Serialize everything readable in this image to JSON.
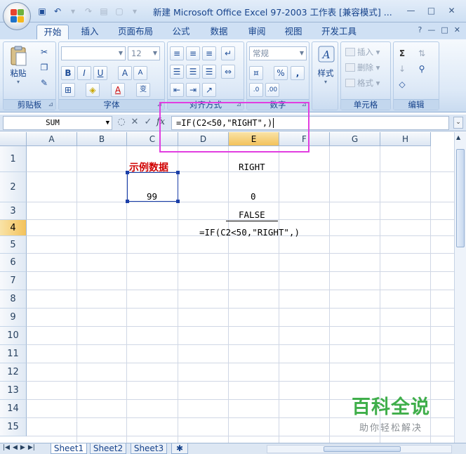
{
  "window": {
    "title": "新建 Microsoft Office Excel 97-2003 工作表 [兼容模式] ...",
    "controls": [
      "—",
      "□",
      "✕"
    ]
  },
  "quick_access": {
    "save_icon": "save-icon",
    "undo_icon": "undo-icon",
    "redo_icon": "redo-icon"
  },
  "tabs": [
    "开始",
    "插入",
    "页面布局",
    "公式",
    "数据",
    "审阅",
    "视图",
    "开发工具"
  ],
  "tab_controls": [
    "?",
    "—",
    "□",
    "✕"
  ],
  "ribbon": {
    "clipboard": {
      "label": "剪贴板",
      "paste": "粘贴"
    },
    "font": {
      "label": "字体",
      "font_name": "",
      "font_size": "12"
    },
    "alignment": {
      "label": "对齐方式"
    },
    "number": {
      "label": "数字",
      "format": "常规",
      "percent": "%",
      "comma": ","
    },
    "styles": {
      "label": "样式",
      "button": "样式"
    },
    "cells": {
      "label": "单元格",
      "insert": "插入",
      "delete": "删除",
      "format": "格式"
    },
    "editing": {
      "label": "编辑",
      "sigma": "Σ"
    }
  },
  "formula_bar": {
    "name_box": "SUM",
    "fx": "fx",
    "formula": "=IF(C2<50,\"RIGHT\",)"
  },
  "columns": [
    "A",
    "B",
    "C",
    "D",
    "E",
    "F",
    "G",
    "H"
  ],
  "rows": [
    "1",
    "2",
    "3",
    "4",
    "5",
    "6",
    "7",
    "8",
    "9",
    "10",
    "11",
    "12",
    "13",
    "14",
    "15"
  ],
  "cells": {
    "C1": "示例数据",
    "C2": "99",
    "E1": "RIGHT",
    "E2": "0",
    "E3": "FALSE",
    "E4": "=IF(C2<50,\"RIGHT\",)"
  },
  "sheet_tabs": [
    "Sheet1",
    "Sheet2",
    "Sheet3"
  ],
  "watermark": {
    "main": "百科全说",
    "sub": "助你轻松解决"
  },
  "colors": {
    "accent": "#15428b",
    "highlight_box": "#e13ee0",
    "title_cell": "#d00000",
    "watermark_green": "#3fae4a"
  }
}
